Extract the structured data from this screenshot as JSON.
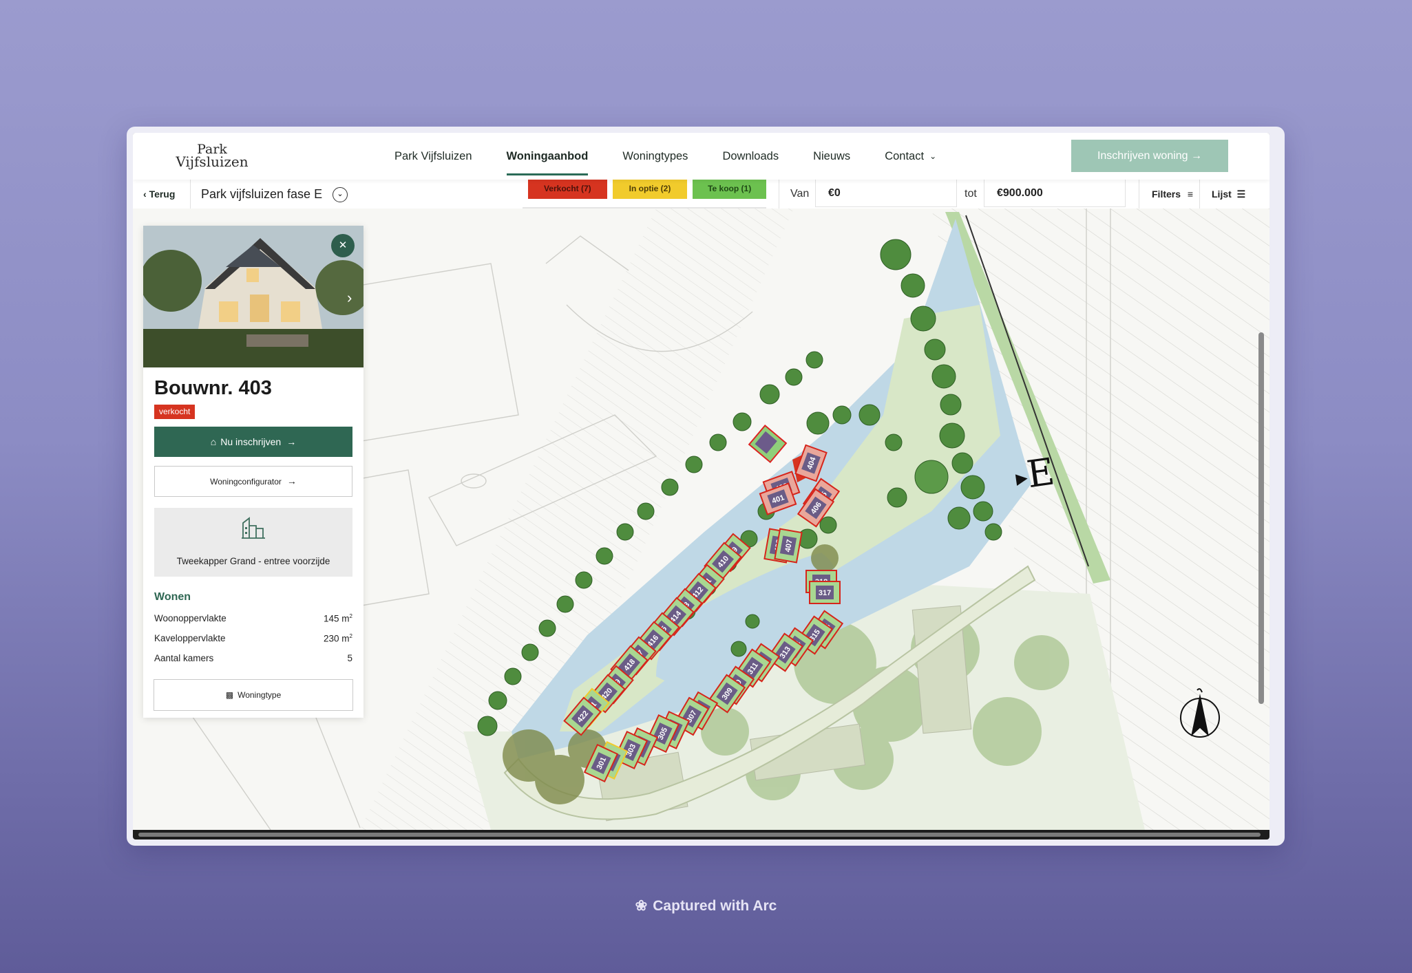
{
  "header": {
    "logo_line1": "Park",
    "logo_line2": "Vijfsluizen",
    "nav": [
      {
        "label": "Park Vijfsluizen"
      },
      {
        "label": "Woningaanbod"
      },
      {
        "label": "Woningtypes"
      },
      {
        "label": "Downloads"
      },
      {
        "label": "Nieuws"
      },
      {
        "label": "Contact"
      }
    ],
    "cta_label": "Inschrijven woning →"
  },
  "toolbar": {
    "back_label": "Terug",
    "phase_label": "Park vijfsluizen fase E",
    "status": {
      "sold": "Verkocht  (7)",
      "option": "In optie  (2)",
      "for_sale": "Te koop  (1)"
    },
    "price_from_label": "Van",
    "price_from_value": "€0",
    "price_to_label": "tot",
    "price_to_value": "€900.000",
    "filters_label": "Filters",
    "list_label": "Lijst"
  },
  "panel": {
    "title": "Bouwnr. 403",
    "status_badge": "verkocht",
    "primary_button": "Nu inschrijven",
    "configurator_button": "Woningconfigurator",
    "house_type": "Tweekapper Grand - entree voorzijde",
    "section_title": "Wonen",
    "specs": [
      {
        "label": "Woonoppervlakte",
        "value": "145 m",
        "unit_sup": "2"
      },
      {
        "label": "Kaveloppervlakte",
        "value": "230 m",
        "unit_sup": "2"
      },
      {
        "label": "Aantal kamers",
        "value": "5",
        "unit_sup": ""
      }
    ],
    "type_button": "Woningtype"
  },
  "map": {
    "phase_letter": "E",
    "plots": [
      "404",
      "402",
      "401",
      "405",
      "406",
      "409",
      "410",
      "408",
      "407",
      "411",
      "412",
      "318",
      "317",
      "413",
      "414",
      "415",
      "416",
      "417",
      "418",
      "419",
      "420",
      "421",
      "422",
      "316",
      "315",
      "314",
      "313",
      "312",
      "311",
      "310",
      "309",
      "308",
      "307",
      "306",
      "305",
      "304",
      "303",
      "302",
      "301"
    ],
    "zoom_in": "+",
    "zoom_out": "−"
  },
  "colors": {
    "brand_green": "#2f6753",
    "cta_green": "#9ec6b5",
    "sold_red": "#d63420",
    "option_yellow": "#f1cb2c",
    "sale_green": "#6cc14f"
  },
  "caption": "Captured with Arc"
}
